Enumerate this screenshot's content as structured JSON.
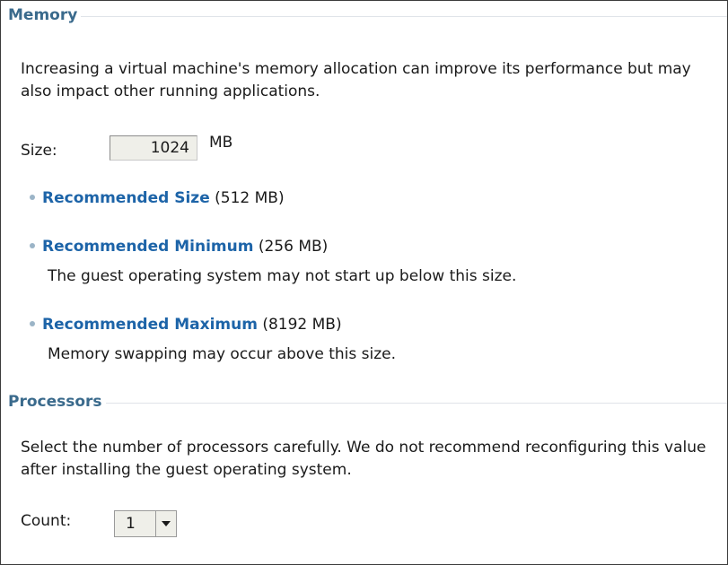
{
  "memory": {
    "title": "Memory",
    "description": "Increasing a virtual machine's memory allocation can improve its performance but may also impact other running applications.",
    "size_label": "Size:",
    "size_value": "1024",
    "size_unit": "MB",
    "recommendations": [
      {
        "link": "Recommended Size",
        "value": "(512 MB)",
        "note": ""
      },
      {
        "link": "Recommended Minimum",
        "value": "(256 MB)",
        "note": "The guest operating system may not start up below this size."
      },
      {
        "link": "Recommended Maximum",
        "value": "(8192 MB)",
        "note": "Memory swapping may occur above this size."
      }
    ]
  },
  "processors": {
    "title": "Processors",
    "description": "Select the number of processors carefully. We do not recommend reconfiguring this value after installing the guest operating system.",
    "count_label": "Count:",
    "count_value": "1"
  },
  "colors": {
    "section_title": "#3a6a8c",
    "link": "#1d64a8",
    "bullet": "#9bb4c7",
    "input_bg": "#efefe9"
  },
  "icons": {
    "bullet": "bullet-dot-icon",
    "dropdown": "chevron-down-icon"
  }
}
